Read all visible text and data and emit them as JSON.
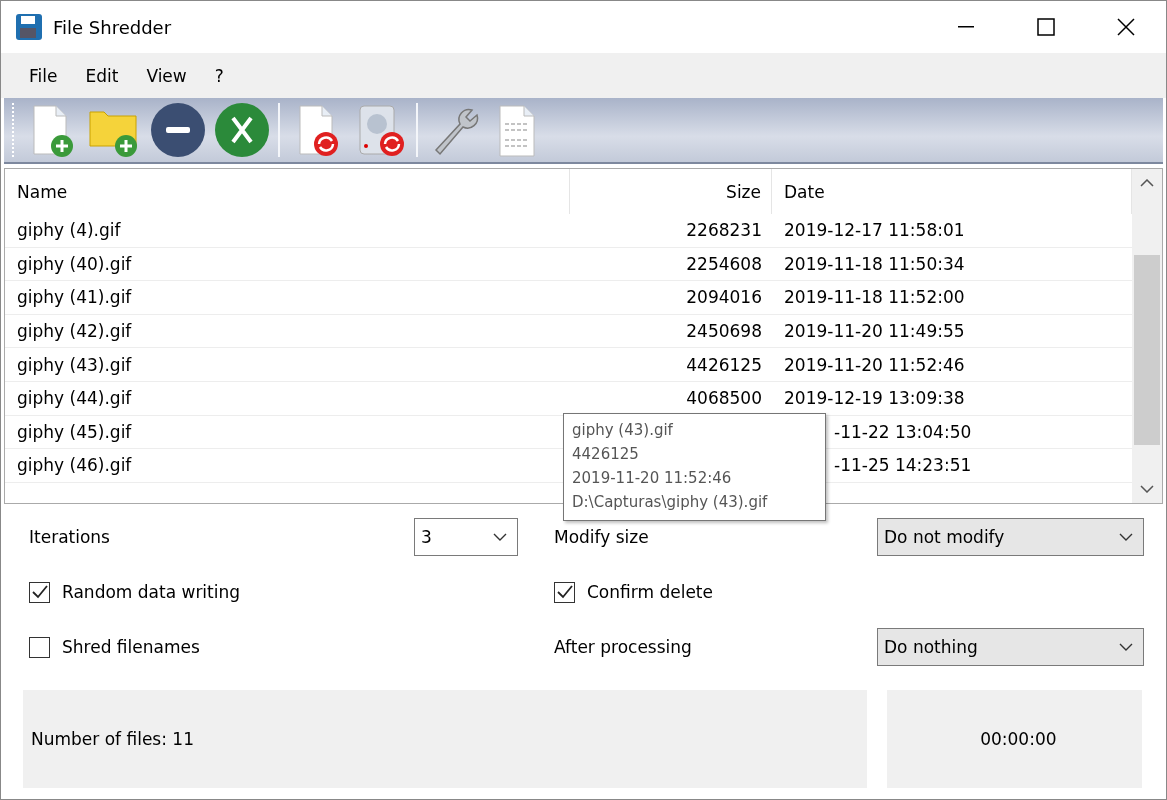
{
  "window": {
    "title": "File Shredder"
  },
  "menu": [
    "File",
    "Edit",
    "View",
    "?"
  ],
  "table": {
    "columns": [
      "Name",
      "Size",
      "Date"
    ],
    "rows": [
      {
        "name": "giphy (4).gif",
        "size": "2268231",
        "date": "2019-12-17 11:58:01"
      },
      {
        "name": "giphy (40).gif",
        "size": "2254608",
        "date": "2019-11-18 11:50:34"
      },
      {
        "name": "giphy (41).gif",
        "size": "2094016",
        "date": "2019-11-18 11:52:00"
      },
      {
        "name": "giphy (42).gif",
        "size": "2450698",
        "date": "2019-11-20 11:49:55"
      },
      {
        "name": "giphy (43).gif",
        "size": "4426125",
        "date": "2019-11-20 11:52:46"
      },
      {
        "name": "giphy (44).gif",
        "size": "4068500",
        "date": "2019-12-19 13:09:38"
      },
      {
        "name": "giphy (45).gif",
        "date": "-11-22 13:04:50"
      },
      {
        "name": "giphy (46).gif",
        "date": "-11-25 14:23:51"
      }
    ]
  },
  "tooltip": {
    "lines": [
      "giphy (43).gif",
      "4426125",
      "2019-11-20 11:52:46",
      "D:\\Capturas\\giphy (43).gif"
    ]
  },
  "options": {
    "iterations": {
      "label": "Iterations",
      "value": "3"
    },
    "modify_size": {
      "label": "Modify size",
      "value": "Do not modify"
    },
    "random_data": {
      "label": "Random data writing",
      "checked": true
    },
    "confirm_delete": {
      "label": "Confirm delete",
      "checked": true
    },
    "shred_filenames": {
      "label": "Shred filenames",
      "checked": false
    },
    "after_processing": {
      "label": "After processing",
      "value": "Do nothing"
    }
  },
  "status": {
    "file_count": "Number of files: 11",
    "elapsed": "00:00:00"
  }
}
